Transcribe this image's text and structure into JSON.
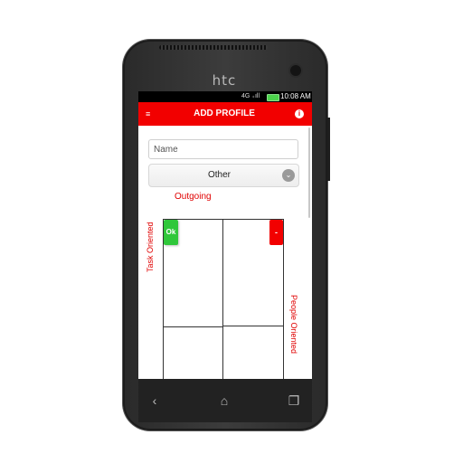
{
  "device": {
    "brand": "htc"
  },
  "statusbar": {
    "signal_glyphs": "4G ₊ıll",
    "time": "10:08 AM"
  },
  "appbar": {
    "title": "ADD PROFILE",
    "menu_icon": "≡",
    "info_icon": "i"
  },
  "form": {
    "name_placeholder": "Name",
    "name_value": "",
    "select_value": "Other",
    "select_arrow": "⌄"
  },
  "chart": {
    "top_label": "Outgoing",
    "left_label": "Task Oriented",
    "right_label": "People Oriented",
    "ok_label": "Ok",
    "minus_label": "-"
  },
  "navbar": {
    "back": "‹",
    "home": "⌂",
    "recent": "❐"
  },
  "colors": {
    "accent": "#f20000",
    "ok": "#2fc73a"
  }
}
